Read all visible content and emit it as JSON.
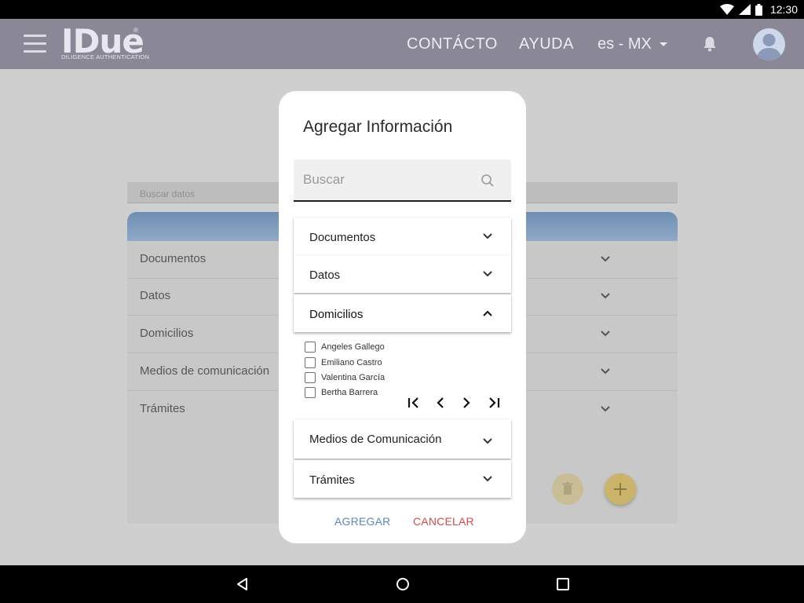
{
  "status_bar": {
    "time": "12:30"
  },
  "app_bar": {
    "logo_text": "IDue",
    "logo_tagline": "DILIGENCE AUTHENTICATION",
    "logo_reg": "®",
    "nav": [
      "CONTÁCTO",
      "AYUDA"
    ],
    "language": "es - MX"
  },
  "background": {
    "search_placeholder": "Buscar datos",
    "rows": [
      "Documentos",
      "Datos",
      "Domicilios",
      "Medios de comunicación",
      "Trámites"
    ]
  },
  "dialog": {
    "title": "Agregar Información",
    "search_placeholder": "Buscar",
    "sections": [
      {
        "label": "Documentos",
        "expanded": false
      },
      {
        "label": "Datos",
        "expanded": false
      },
      {
        "label": "Domicilios",
        "expanded": true
      },
      {
        "label": "Medios de Comunicación",
        "expanded": false
      },
      {
        "label": "Trámites",
        "expanded": false
      }
    ],
    "domicilios_options": [
      "Angeles Gallego",
      "Emiliano Castro",
      "Valentina García",
      "Bertha Barrera"
    ],
    "actions": {
      "add": "AGREGAR",
      "cancel": "CANCELAR"
    }
  },
  "colors": {
    "app_bar": "#8a8796",
    "add_action": "#5a86c4",
    "cancel_action": "#d94a4a",
    "fab_add": "#cbb36a"
  }
}
